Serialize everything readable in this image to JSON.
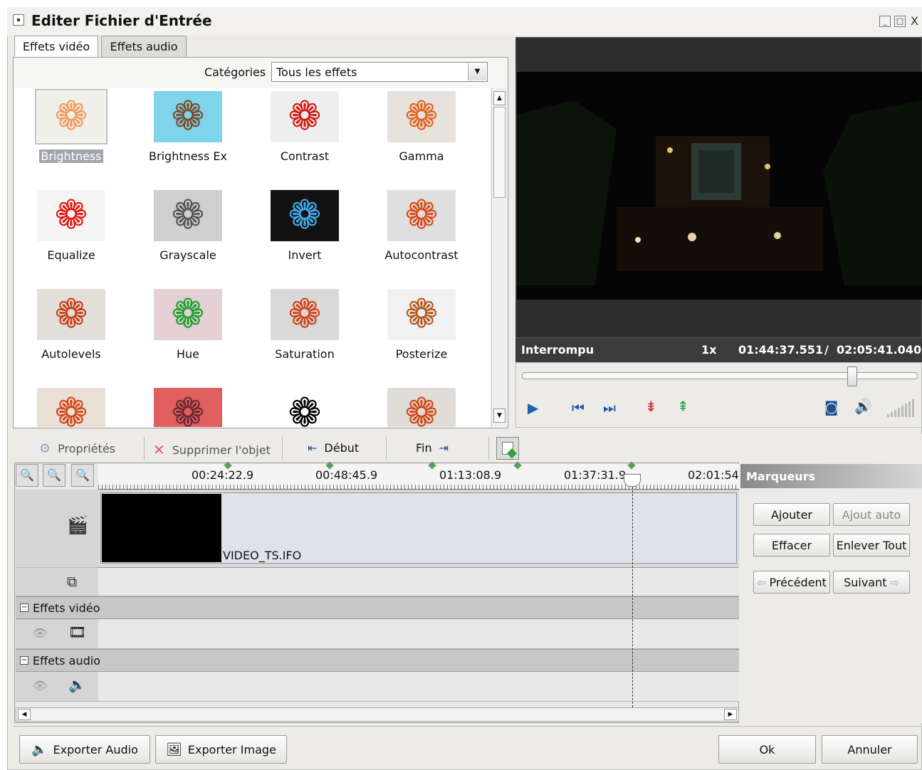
{
  "window": {
    "title": "Editer Fichier d'Entrée"
  },
  "tabs": [
    {
      "label": "Effets vidéo",
      "active": true
    },
    {
      "label": "Effets audio",
      "active": false
    }
  ],
  "categories": {
    "label": "Catégories",
    "selected": "Tous les effets"
  },
  "effects": [
    {
      "label": "Brightness",
      "color": "#f39a5c",
      "bg": "#f0efe9",
      "selected": true
    },
    {
      "label": "Brightness Ex",
      "color": "#7a4a2a",
      "bg": "#7fd3ea",
      "selected": false
    },
    {
      "label": "Contrast",
      "color": "#d21a12",
      "bg": "#eeeeee",
      "selected": false
    },
    {
      "label": "Gamma",
      "color": "#e2651e",
      "bg": "#e7e2dc",
      "selected": false
    },
    {
      "label": "Equalize",
      "color": "#e01a10",
      "bg": "#f5f5f5",
      "selected": false
    },
    {
      "label": "Grayscale",
      "color": "#555555",
      "bg": "#cfcfcf",
      "selected": false
    },
    {
      "label": "Invert",
      "color": "#42a9ea",
      "bg": "#121212",
      "selected": false
    },
    {
      "label": "Autocontrast",
      "color": "#d94a18",
      "bg": "#dfdfdf",
      "selected": false
    },
    {
      "label": "Autolevels",
      "color": "#c8401a",
      "bg": "#e2dfdb",
      "selected": false
    },
    {
      "label": "Hue",
      "color": "#1aa02c",
      "bg": "#e4cfd4",
      "selected": false
    },
    {
      "label": "Saturation",
      "color": "#d2441a",
      "bg": "#d9d9d9",
      "selected": false
    },
    {
      "label": "Posterize",
      "color": "#b5581c",
      "bg": "#f1f1f1",
      "selected": false
    },
    {
      "label": "",
      "color": "#d2481a",
      "bg": "#eadfd5",
      "selected": false
    },
    {
      "label": "",
      "color": "#6a2830",
      "bg": "#e06060",
      "selected": false
    },
    {
      "label": "",
      "color": "#000000",
      "bg": "#ffffff",
      "selected": false
    },
    {
      "label": "",
      "color": "#d2481a",
      "bg": "#e0ddd8",
      "selected": false
    }
  ],
  "player": {
    "status": "Interrompu",
    "speed": "1x",
    "current_time": "01:44:37.551",
    "separator": "/",
    "total_time": "02:05:41.040",
    "position_fraction": 0.834
  },
  "toolbar": {
    "properties": "Propriétés",
    "delete": "Supprimer l'objet",
    "start": "Début",
    "end": "Fin"
  },
  "timeline": {
    "ticks": [
      "00:24:22.9",
      "00:48:45.9",
      "01:13:08.9",
      "01:37:31.9",
      "02:01:54"
    ],
    "clip_name": "VIDEO_TS.IFO",
    "video_effects_label": "Effets vidéo",
    "audio_effects_label": "Effets audio"
  },
  "markers": {
    "title": "Marqueurs",
    "add": "Ajouter",
    "auto_add": "Ajout auto",
    "clear": "Effacer",
    "remove_all": "Enlever Tout",
    "previous": "Précédent",
    "next": "Suivant"
  },
  "footer": {
    "export_audio": "Exporter Audio",
    "export_image": "Exporter Image",
    "ok": "Ok",
    "cancel": "Annuler"
  },
  "icons": {
    "leaf": "maple-leaf-icon"
  }
}
